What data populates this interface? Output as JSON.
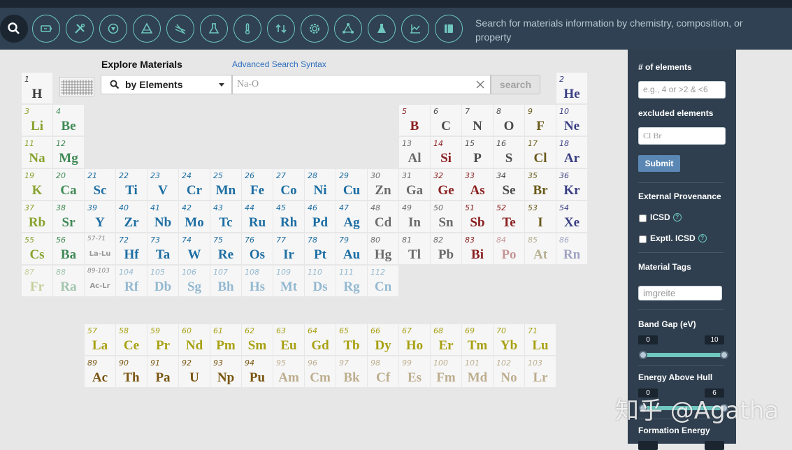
{
  "nav": {
    "description": "Search for materials information by chemistry, composition, or property",
    "icons": [
      "search-icon",
      "battery-icon",
      "tools-icon",
      "filter-down-icon",
      "prism-icon",
      "grid-lines-icon",
      "flask-icon",
      "thermometer-icon",
      "swap-icon",
      "gear-ring-icon",
      "network-icon",
      "beaker-icon",
      "chart-icon",
      "book-icon"
    ]
  },
  "search": {
    "title": "Explore Materials",
    "advanced_link": "Advanced Search Syntax",
    "mode_label": "by Elements",
    "placeholder": "Na-O",
    "button": "search"
  },
  "sidebar": {
    "num_elements_label": "# of elements",
    "num_elements_placeholder": "e.g., 4 or >2 & <6",
    "excluded_label": "excluded elements",
    "excluded_placeholder": "Cl Br",
    "submit": "Submit",
    "provenance_label": "External Provenance",
    "icsd_label": "ICSD",
    "exptl_icsd_label": "Exptl. ICSD",
    "tags_label": "Material Tags",
    "tags_placeholder": "imgreite",
    "band_gap_label": "Band Gap (eV)",
    "band_gap_min": "0",
    "band_gap_max": "10",
    "hull_label": "Energy Above Hull",
    "hull_min": "0",
    "hull_max": "6",
    "formation_label": "Formation Energy"
  },
  "periodic_table": [
    {
      "n": "1",
      "s": "H",
      "r": 1,
      "c": 1,
      "g": "nonmetal hy"
    },
    {
      "n": "2",
      "s": "He",
      "r": 1,
      "c": 18,
      "g": "noble"
    },
    {
      "n": "3",
      "s": "Li",
      "r": 2,
      "c": 1,
      "g": "alkali"
    },
    {
      "n": "4",
      "s": "Be",
      "r": 2,
      "c": 2,
      "g": "alkaline"
    },
    {
      "n": "5",
      "s": "B",
      "r": 2,
      "c": 13,
      "g": "metalloid"
    },
    {
      "n": "6",
      "s": "C",
      "r": 2,
      "c": 14,
      "g": "nonmetal"
    },
    {
      "n": "7",
      "s": "N",
      "r": 2,
      "c": 15,
      "g": "nonmetal"
    },
    {
      "n": "8",
      "s": "O",
      "r": 2,
      "c": 16,
      "g": "nonmetal"
    },
    {
      "n": "9",
      "s": "F",
      "r": 2,
      "c": 17,
      "g": "halogen"
    },
    {
      "n": "10",
      "s": "Ne",
      "r": 2,
      "c": 18,
      "g": "noble"
    },
    {
      "n": "11",
      "s": "Na",
      "r": 3,
      "c": 1,
      "g": "alkali"
    },
    {
      "n": "12",
      "s": "Mg",
      "r": 3,
      "c": 2,
      "g": "alkaline"
    },
    {
      "n": "13",
      "s": "Al",
      "r": 3,
      "c": 13,
      "g": "post"
    },
    {
      "n": "14",
      "s": "Si",
      "r": 3,
      "c": 14,
      "g": "metalloid"
    },
    {
      "n": "15",
      "s": "P",
      "r": 3,
      "c": 15,
      "g": "nonmetal"
    },
    {
      "n": "16",
      "s": "S",
      "r": 3,
      "c": 16,
      "g": "nonmetal"
    },
    {
      "n": "17",
      "s": "Cl",
      "r": 3,
      "c": 17,
      "g": "halogen"
    },
    {
      "n": "18",
      "s": "Ar",
      "r": 3,
      "c": 18,
      "g": "noble"
    },
    {
      "n": "19",
      "s": "K",
      "r": 4,
      "c": 1,
      "g": "alkali"
    },
    {
      "n": "20",
      "s": "Ca",
      "r": 4,
      "c": 2,
      "g": "alkaline"
    },
    {
      "n": "21",
      "s": "Sc",
      "r": 4,
      "c": 3,
      "g": "transition"
    },
    {
      "n": "22",
      "s": "Ti",
      "r": 4,
      "c": 4,
      "g": "transition"
    },
    {
      "n": "23",
      "s": "V",
      "r": 4,
      "c": 5,
      "g": "transition"
    },
    {
      "n": "24",
      "s": "Cr",
      "r": 4,
      "c": 6,
      "g": "transition"
    },
    {
      "n": "25",
      "s": "Mn",
      "r": 4,
      "c": 7,
      "g": "transition"
    },
    {
      "n": "26",
      "s": "Fe",
      "r": 4,
      "c": 8,
      "g": "transition"
    },
    {
      "n": "27",
      "s": "Co",
      "r": 4,
      "c": 9,
      "g": "transition"
    },
    {
      "n": "28",
      "s": "Ni",
      "r": 4,
      "c": 10,
      "g": "transition"
    },
    {
      "n": "29",
      "s": "Cu",
      "r": 4,
      "c": 11,
      "g": "transition"
    },
    {
      "n": "30",
      "s": "Zn",
      "r": 4,
      "c": 12,
      "g": "post"
    },
    {
      "n": "31",
      "s": "Ga",
      "r": 4,
      "c": 13,
      "g": "post"
    },
    {
      "n": "32",
      "s": "Ge",
      "r": 4,
      "c": 14,
      "g": "metalloid"
    },
    {
      "n": "33",
      "s": "As",
      "r": 4,
      "c": 15,
      "g": "metalloid"
    },
    {
      "n": "34",
      "s": "Se",
      "r": 4,
      "c": 16,
      "g": "nonmetal"
    },
    {
      "n": "35",
      "s": "Br",
      "r": 4,
      "c": 17,
      "g": "halogen"
    },
    {
      "n": "36",
      "s": "Kr",
      "r": 4,
      "c": 18,
      "g": "noble"
    },
    {
      "n": "37",
      "s": "Rb",
      "r": 5,
      "c": 1,
      "g": "alkali"
    },
    {
      "n": "38",
      "s": "Sr",
      "r": 5,
      "c": 2,
      "g": "alkaline"
    },
    {
      "n": "39",
      "s": "Y",
      "r": 5,
      "c": 3,
      "g": "transition"
    },
    {
      "n": "40",
      "s": "Zr",
      "r": 5,
      "c": 4,
      "g": "transition"
    },
    {
      "n": "41",
      "s": "Nb",
      "r": 5,
      "c": 5,
      "g": "transition"
    },
    {
      "n": "42",
      "s": "Mo",
      "r": 5,
      "c": 6,
      "g": "transition"
    },
    {
      "n": "43",
      "s": "Tc",
      "r": 5,
      "c": 7,
      "g": "transition"
    },
    {
      "n": "44",
      "s": "Ru",
      "r": 5,
      "c": 8,
      "g": "transition"
    },
    {
      "n": "45",
      "s": "Rh",
      "r": 5,
      "c": 9,
      "g": "transition"
    },
    {
      "n": "46",
      "s": "Pd",
      "r": 5,
      "c": 10,
      "g": "transition"
    },
    {
      "n": "47",
      "s": "Ag",
      "r": 5,
      "c": 11,
      "g": "transition"
    },
    {
      "n": "48",
      "s": "Cd",
      "r": 5,
      "c": 12,
      "g": "post"
    },
    {
      "n": "49",
      "s": "In",
      "r": 5,
      "c": 13,
      "g": "post"
    },
    {
      "n": "50",
      "s": "Sn",
      "r": 5,
      "c": 14,
      "g": "post"
    },
    {
      "n": "51",
      "s": "Sb",
      "r": 5,
      "c": 15,
      "g": "metalloid"
    },
    {
      "n": "52",
      "s": "Te",
      "r": 5,
      "c": 16,
      "g": "metalloid"
    },
    {
      "n": "53",
      "s": "I",
      "r": 5,
      "c": 17,
      "g": "halogen"
    },
    {
      "n": "54",
      "s": "Xe",
      "r": 5,
      "c": 18,
      "g": "noble"
    },
    {
      "n": "55",
      "s": "Cs",
      "r": 6,
      "c": 1,
      "g": "alkali"
    },
    {
      "n": "56",
      "s": "Ba",
      "r": 6,
      "c": 2,
      "g": "alkaline"
    },
    {
      "n": "57-71",
      "s": "La-Lu",
      "r": 6,
      "c": 3,
      "g": "placeholder"
    },
    {
      "n": "72",
      "s": "Hf",
      "r": 6,
      "c": 4,
      "g": "transition"
    },
    {
      "n": "73",
      "s": "Ta",
      "r": 6,
      "c": 5,
      "g": "transition"
    },
    {
      "n": "74",
      "s": "W",
      "r": 6,
      "c": 6,
      "g": "transition"
    },
    {
      "n": "75",
      "s": "Re",
      "r": 6,
      "c": 7,
      "g": "transition"
    },
    {
      "n": "76",
      "s": "Os",
      "r": 6,
      "c": 8,
      "g": "transition"
    },
    {
      "n": "77",
      "s": "Ir",
      "r": 6,
      "c": 9,
      "g": "transition"
    },
    {
      "n": "78",
      "s": "Pt",
      "r": 6,
      "c": 10,
      "g": "transition"
    },
    {
      "n": "79",
      "s": "Au",
      "r": 6,
      "c": 11,
      "g": "transition"
    },
    {
      "n": "80",
      "s": "Hg",
      "r": 6,
      "c": 12,
      "g": "post"
    },
    {
      "n": "81",
      "s": "Tl",
      "r": 6,
      "c": 13,
      "g": "post"
    },
    {
      "n": "82",
      "s": "Pb",
      "r": 6,
      "c": 14,
      "g": "post"
    },
    {
      "n": "83",
      "s": "Bi",
      "r": 6,
      "c": 15,
      "g": "metalloid"
    },
    {
      "n": "84",
      "s": "Po",
      "r": 6,
      "c": 16,
      "g": "metalloid faded"
    },
    {
      "n": "85",
      "s": "At",
      "r": 6,
      "c": 17,
      "g": "halogen faded"
    },
    {
      "n": "86",
      "s": "Rn",
      "r": 6,
      "c": 18,
      "g": "noble faded"
    },
    {
      "n": "87",
      "s": "Fr",
      "r": 7,
      "c": 1,
      "g": "alkali faded"
    },
    {
      "n": "88",
      "s": "Ra",
      "r": 7,
      "c": 2,
      "g": "alkaline faded"
    },
    {
      "n": "89-103",
      "s": "Ac-Lr",
      "r": 7,
      "c": 3,
      "g": "placeholder"
    },
    {
      "n": "104",
      "s": "Rf",
      "r": 7,
      "c": 4,
      "g": "transition faded"
    },
    {
      "n": "105",
      "s": "Db",
      "r": 7,
      "c": 5,
      "g": "transition faded"
    },
    {
      "n": "106",
      "s": "Sg",
      "r": 7,
      "c": 6,
      "g": "transition faded"
    },
    {
      "n": "107",
      "s": "Bh",
      "r": 7,
      "c": 7,
      "g": "transition faded"
    },
    {
      "n": "108",
      "s": "Hs",
      "r": 7,
      "c": 8,
      "g": "transition faded"
    },
    {
      "n": "109",
      "s": "Mt",
      "r": 7,
      "c": 9,
      "g": "transition faded"
    },
    {
      "n": "110",
      "s": "Ds",
      "r": 7,
      "c": 10,
      "g": "transition faded"
    },
    {
      "n": "111",
      "s": "Rg",
      "r": 7,
      "c": 11,
      "g": "transition faded"
    },
    {
      "n": "112",
      "s": "Cn",
      "r": 7,
      "c": 12,
      "g": "transition faded"
    },
    {
      "n": "57",
      "s": "La",
      "r": 9,
      "c": 3,
      "g": "lanth"
    },
    {
      "n": "58",
      "s": "Ce",
      "r": 9,
      "c": 4,
      "g": "lanth"
    },
    {
      "n": "59",
      "s": "Pr",
      "r": 9,
      "c": 5,
      "g": "lanth"
    },
    {
      "n": "60",
      "s": "Nd",
      "r": 9,
      "c": 6,
      "g": "lanth"
    },
    {
      "n": "61",
      "s": "Pm",
      "r": 9,
      "c": 7,
      "g": "lanth"
    },
    {
      "n": "62",
      "s": "Sm",
      "r": 9,
      "c": 8,
      "g": "lanth"
    },
    {
      "n": "63",
      "s": "Eu",
      "r": 9,
      "c": 9,
      "g": "lanth"
    },
    {
      "n": "64",
      "s": "Gd",
      "r": 9,
      "c": 10,
      "g": "lanth"
    },
    {
      "n": "65",
      "s": "Tb",
      "r": 9,
      "c": 11,
      "g": "lanth"
    },
    {
      "n": "66",
      "s": "Dy",
      "r": 9,
      "c": 12,
      "g": "lanth"
    },
    {
      "n": "67",
      "s": "Ho",
      "r": 9,
      "c": 13,
      "g": "lanth"
    },
    {
      "n": "68",
      "s": "Er",
      "r": 9,
      "c": 14,
      "g": "lanth"
    },
    {
      "n": "69",
      "s": "Tm",
      "r": 9,
      "c": 15,
      "g": "lanth"
    },
    {
      "n": "70",
      "s": "Yb",
      "r": 9,
      "c": 16,
      "g": "lanth"
    },
    {
      "n": "71",
      "s": "Lu",
      "r": 9,
      "c": 17,
      "g": "lanth"
    },
    {
      "n": "89",
      "s": "Ac",
      "r": 10,
      "c": 3,
      "g": "act"
    },
    {
      "n": "90",
      "s": "Th",
      "r": 10,
      "c": 4,
      "g": "act"
    },
    {
      "n": "91",
      "s": "Pa",
      "r": 10,
      "c": 5,
      "g": "act"
    },
    {
      "n": "92",
      "s": "U",
      "r": 10,
      "c": 6,
      "g": "act"
    },
    {
      "n": "93",
      "s": "Np",
      "r": 10,
      "c": 7,
      "g": "act"
    },
    {
      "n": "94",
      "s": "Pu",
      "r": 10,
      "c": 8,
      "g": "act"
    },
    {
      "n": "95",
      "s": "Am",
      "r": 10,
      "c": 9,
      "g": "act faded"
    },
    {
      "n": "96",
      "s": "Cm",
      "r": 10,
      "c": 10,
      "g": "act faded"
    },
    {
      "n": "97",
      "s": "Bk",
      "r": 10,
      "c": 11,
      "g": "act faded"
    },
    {
      "n": "98",
      "s": "Cf",
      "r": 10,
      "c": 12,
      "g": "act faded"
    },
    {
      "n": "99",
      "s": "Es",
      "r": 10,
      "c": 13,
      "g": "act faded"
    },
    {
      "n": "100",
      "s": "Fm",
      "r": 10,
      "c": 14,
      "g": "act faded"
    },
    {
      "n": "101",
      "s": "Md",
      "r": 10,
      "c": 15,
      "g": "act faded"
    },
    {
      "n": "102",
      "s": "No",
      "r": 10,
      "c": 16,
      "g": "act faded"
    },
    {
      "n": "103",
      "s": "Lr",
      "r": 10,
      "c": 17,
      "g": "act faded"
    }
  ],
  "watermark": "知乎 @Agatha"
}
